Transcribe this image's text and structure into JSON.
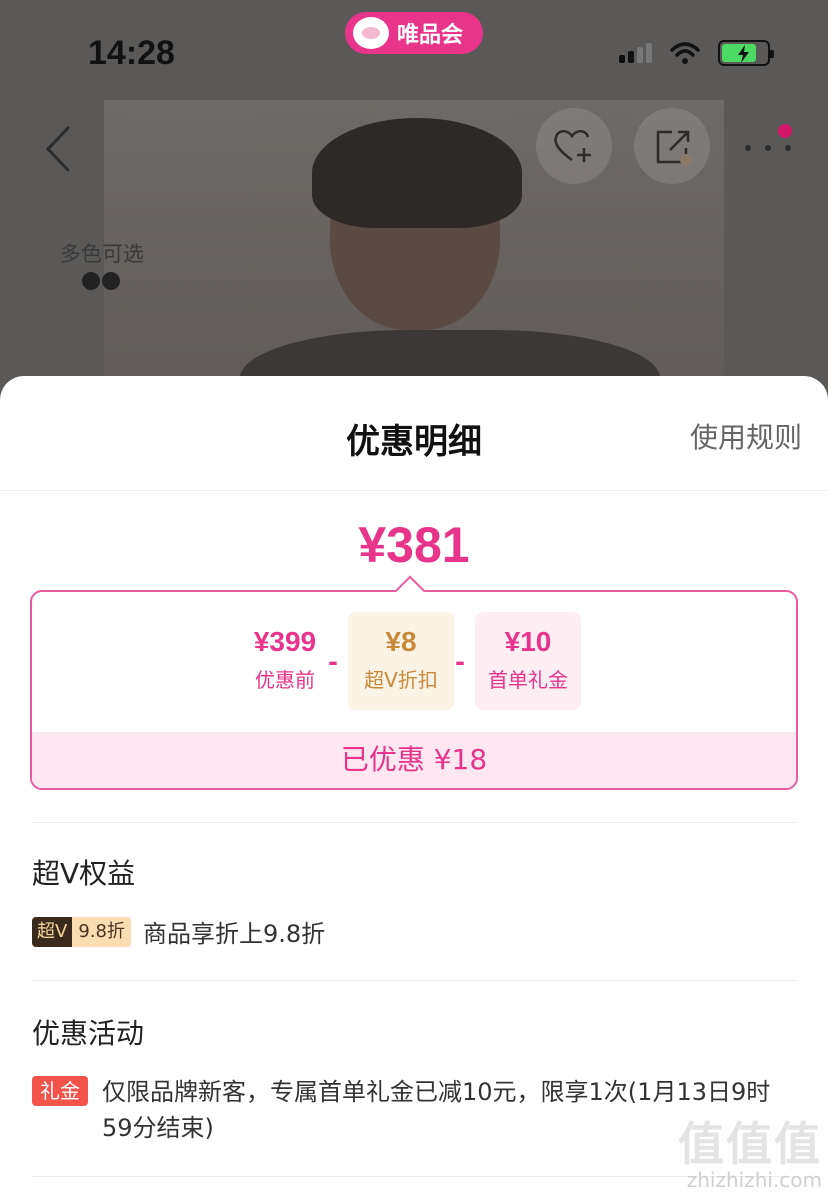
{
  "status_bar": {
    "time": "14:28"
  },
  "brand": {
    "name": "唯品会",
    "accent": "#e8348a"
  },
  "product_header": {
    "colors_label": "多色可选",
    "icons": [
      "back-icon",
      "favorite-add-icon",
      "share-icon",
      "more-icon"
    ]
  },
  "sheet": {
    "title": "优惠明细",
    "rules_link": "使用规则",
    "final_price": "¥381",
    "breakdown": [
      {
        "amount": "¥399",
        "label": "优惠前"
      },
      {
        "amount": "¥8",
        "label": "超V折扣"
      },
      {
        "amount": "¥10",
        "label": "首单礼金"
      }
    ],
    "operator": "-",
    "saved": "已优惠 ¥18"
  },
  "super_v": {
    "title": "超V权益",
    "tag_left": "超V",
    "tag_right": "9.8折",
    "text": "商品享折上9.8折"
  },
  "promotions": {
    "title": "优惠活动",
    "tag": "礼金",
    "text": "仅限品牌新客，专属首单礼金已减10元，限享1次(1月13日9时59分结束)"
  },
  "watermark": {
    "big": "值值值",
    "small": "zhizhizhi.com"
  }
}
